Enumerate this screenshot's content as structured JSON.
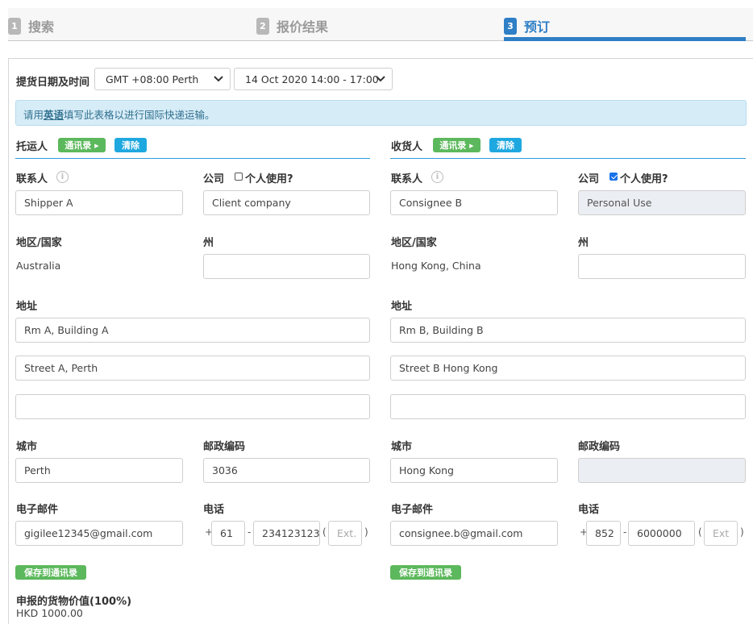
{
  "steps": [
    {
      "num": "1",
      "label": "搜索"
    },
    {
      "num": "2",
      "label": "报价结果"
    },
    {
      "num": "3",
      "label": "预订"
    }
  ],
  "pickup": {
    "label": "提货日期及时间",
    "timezone": "GMT +08:00 Perth",
    "datetime": "14 Oct 2020 14:00 - 17:00"
  },
  "notice": {
    "prefix": "请用",
    "emphasis": "英语",
    "suffix": "填写此表格以进行国际快递运输。"
  },
  "shipper": {
    "title": "托运人",
    "contacts_btn": "通讯录 ▸",
    "clear_btn": "清除",
    "contact_label": "联系人",
    "contact_value": "Shipper A",
    "company_label": "公司",
    "personal_label": "个人使用?",
    "company_value": "Client company",
    "region_label": "地区/国家",
    "region_value": "Australia",
    "state_label": "州",
    "state_value": "",
    "address_label": "地址",
    "address1": "Rm A, Building A",
    "address2": "Street A, Perth",
    "address3": "",
    "city_label": "城市",
    "city_value": "Perth",
    "postal_label": "邮政编码",
    "postal_value": "3036",
    "email_label": "电子邮件",
    "email_value": "gigilee12345@gmail.com",
    "phone_label": "电话",
    "phone_plus": "+",
    "phone_code": "61",
    "phone_dash": "-",
    "phone_number": "234123123",
    "ext_open": "(",
    "ext_placeholder": "Ext.",
    "ext_close": ")",
    "save_btn": "保存到通讯录"
  },
  "consignee": {
    "title": "收货人",
    "contacts_btn": "通讯录 ▸",
    "clear_btn": "清除",
    "contact_label": "联系人",
    "contact_value": "Consignee B",
    "company_label": "公司",
    "personal_label": "个人使用?",
    "company_value": "Personal Use",
    "region_label": "地区/国家",
    "region_value": "Hong Kong, China",
    "state_label": "州",
    "state_value": "",
    "address_label": "地址",
    "address1": "Rm B, Building B",
    "address2": "Street B Hong Kong",
    "address3": "",
    "city_label": "城市",
    "city_value": "Hong Kong",
    "postal_label": "邮政编码",
    "postal_value": "",
    "email_label": "电子邮件",
    "email_value": "consignee.b@gmail.com",
    "phone_label": "电话",
    "phone_plus": "+",
    "phone_code": "852",
    "phone_dash": "-",
    "phone_number": "6000000",
    "ext_open": "(",
    "ext_placeholder": "Ext",
    "ext_close": ")",
    "save_btn": "保存到通讯录"
  },
  "declared": {
    "label": "申报的货物价值(100%)",
    "value": "HKD 1000.00"
  },
  "colors": {
    "accent": "#2e7fc6",
    "green": "#5cb85c",
    "cyan": "#1fa8e0",
    "notice_bg": "#d6ecf7"
  }
}
